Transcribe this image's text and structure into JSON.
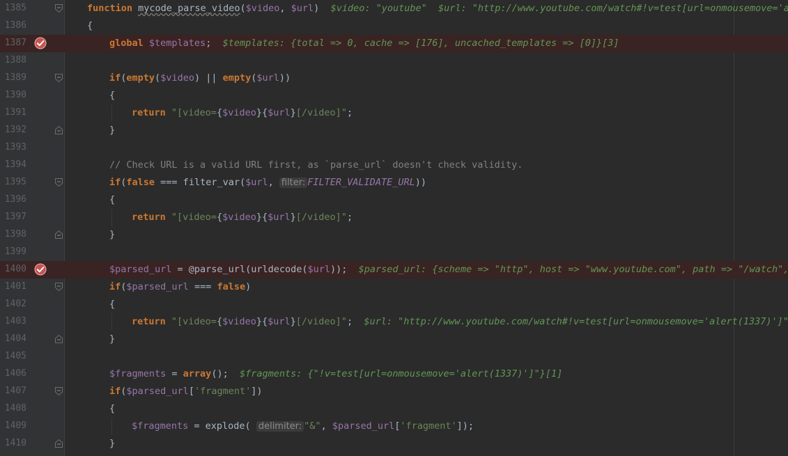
{
  "editor": {
    "colors": {
      "background": "#2b2b2b",
      "gutter": "#313335",
      "breakpoint_line": "#3a2323",
      "breakpoint_icon": "#c75450",
      "keyword": "#cc7832",
      "variable": "#9876aa",
      "string": "#6a8759",
      "comment": "#808080",
      "inline_value": "#629755"
    },
    "icons": {
      "breakpoint": "verified-breakpoint-icon",
      "fold": "fold-marker-icon"
    },
    "lines": [
      {
        "num": "1385",
        "breakpoint": false,
        "fold": "top",
        "indent": 0,
        "tokens": [
          {
            "t": "kw",
            "v": "function "
          },
          {
            "t": "fn-ul",
            "v": "mycode_parse_video"
          },
          {
            "t": "plain",
            "v": "("
          },
          {
            "t": "var",
            "v": "$video"
          },
          {
            "t": "plain",
            "v": ", "
          },
          {
            "t": "var",
            "v": "$url"
          },
          {
            "t": "plain",
            "v": ")  "
          },
          {
            "t": "inline-val",
            "v": "$video: \"youtube\"  $url: \"http://www.youtube.com/watch#!v=test[url=onmousemove='al"
          }
        ]
      },
      {
        "num": "1386",
        "breakpoint": false,
        "fold": null,
        "indent": 0,
        "tokens": [
          {
            "t": "plain",
            "v": "{"
          }
        ]
      },
      {
        "num": "1387",
        "breakpoint": true,
        "fold": null,
        "indent": 1,
        "tokens": [
          {
            "t": "kw",
            "v": "global "
          },
          {
            "t": "var",
            "v": "$templates"
          },
          {
            "t": "plain",
            "v": ";  "
          },
          {
            "t": "inline-val",
            "v": "$templates: {total => 0, cache => [176], uncached_templates => [0]}[3]"
          }
        ]
      },
      {
        "num": "1388",
        "breakpoint": false,
        "fold": null,
        "indent": 1,
        "tokens": []
      },
      {
        "num": "1389",
        "breakpoint": false,
        "fold": "top",
        "indent": 1,
        "tokens": [
          {
            "t": "kw",
            "v": "if"
          },
          {
            "t": "plain",
            "v": "("
          },
          {
            "t": "kw",
            "v": "empty"
          },
          {
            "t": "plain",
            "v": "("
          },
          {
            "t": "var",
            "v": "$video"
          },
          {
            "t": "plain",
            "v": ") || "
          },
          {
            "t": "kw",
            "v": "empty"
          },
          {
            "t": "plain",
            "v": "("
          },
          {
            "t": "var",
            "v": "$url"
          },
          {
            "t": "plain",
            "v": "))"
          }
        ]
      },
      {
        "num": "1390",
        "breakpoint": false,
        "fold": null,
        "indent": 1,
        "tokens": [
          {
            "t": "plain",
            "v": "{"
          }
        ]
      },
      {
        "num": "1391",
        "breakpoint": false,
        "fold": null,
        "indent": 2,
        "tokens": [
          {
            "t": "kw",
            "v": "return "
          },
          {
            "t": "str",
            "v": "\"[video="
          },
          {
            "t": "plain",
            "v": "{"
          },
          {
            "t": "var",
            "v": "$video"
          },
          {
            "t": "plain",
            "v": "}{"
          },
          {
            "t": "var",
            "v": "$url"
          },
          {
            "t": "plain",
            "v": "}"
          },
          {
            "t": "str",
            "v": "[/video]\""
          },
          {
            "t": "plain",
            "v": ";"
          }
        ]
      },
      {
        "num": "1392",
        "breakpoint": false,
        "fold": "bottom",
        "indent": 1,
        "tokens": [
          {
            "t": "plain",
            "v": "}"
          }
        ]
      },
      {
        "num": "1393",
        "breakpoint": false,
        "fold": null,
        "indent": 1,
        "tokens": []
      },
      {
        "num": "1394",
        "breakpoint": false,
        "fold": null,
        "indent": 1,
        "tokens": [
          {
            "t": "cmt",
            "v": "// Check URL is a valid URL first, as `parse_url` doesn't check validity."
          }
        ]
      },
      {
        "num": "1395",
        "breakpoint": false,
        "fold": "top",
        "indent": 1,
        "tokens": [
          {
            "t": "kw",
            "v": "if"
          },
          {
            "t": "plain",
            "v": "("
          },
          {
            "t": "kw",
            "v": "false"
          },
          {
            "t": "plain",
            "v": " === filter_var("
          },
          {
            "t": "var",
            "v": "$url"
          },
          {
            "t": "plain",
            "v": ", "
          },
          {
            "t": "hint",
            "v": "filter:"
          },
          {
            "t": "const",
            "v": "FILTER_VALIDATE_URL"
          },
          {
            "t": "plain",
            "v": "))"
          }
        ]
      },
      {
        "num": "1396",
        "breakpoint": false,
        "fold": null,
        "indent": 1,
        "tokens": [
          {
            "t": "plain",
            "v": "{"
          }
        ]
      },
      {
        "num": "1397",
        "breakpoint": false,
        "fold": null,
        "indent": 2,
        "tokens": [
          {
            "t": "kw",
            "v": "return "
          },
          {
            "t": "str",
            "v": "\"[video="
          },
          {
            "t": "plain",
            "v": "{"
          },
          {
            "t": "var",
            "v": "$video"
          },
          {
            "t": "plain",
            "v": "}{"
          },
          {
            "t": "var",
            "v": "$url"
          },
          {
            "t": "plain",
            "v": "}"
          },
          {
            "t": "str",
            "v": "[/video]\""
          },
          {
            "t": "plain",
            "v": ";"
          }
        ]
      },
      {
        "num": "1398",
        "breakpoint": false,
        "fold": "bottom",
        "indent": 1,
        "tokens": [
          {
            "t": "plain",
            "v": "}"
          }
        ]
      },
      {
        "num": "1399",
        "breakpoint": false,
        "fold": null,
        "indent": 1,
        "tokens": []
      },
      {
        "num": "1400",
        "breakpoint": true,
        "fold": null,
        "indent": 1,
        "tokens": [
          {
            "t": "var",
            "v": "$parsed_url"
          },
          {
            "t": "plain",
            "v": " = @parse_url(urldecode("
          },
          {
            "t": "var",
            "v": "$url"
          },
          {
            "t": "plain",
            "v": "));  "
          },
          {
            "t": "inline-val",
            "v": "$parsed_url: {scheme => \"http\", host => \"www.youtube.com\", path => \"/watch\", f"
          }
        ]
      },
      {
        "num": "1401",
        "breakpoint": false,
        "fold": "top",
        "indent": 1,
        "tokens": [
          {
            "t": "kw",
            "v": "if"
          },
          {
            "t": "plain",
            "v": "("
          },
          {
            "t": "var",
            "v": "$parsed_url"
          },
          {
            "t": "plain",
            "v": " === "
          },
          {
            "t": "kw",
            "v": "false"
          },
          {
            "t": "plain",
            "v": ")"
          }
        ]
      },
      {
        "num": "1402",
        "breakpoint": false,
        "fold": null,
        "indent": 1,
        "tokens": [
          {
            "t": "plain",
            "v": "{"
          }
        ]
      },
      {
        "num": "1403",
        "breakpoint": false,
        "fold": null,
        "indent": 2,
        "tokens": [
          {
            "t": "kw",
            "v": "return "
          },
          {
            "t": "str",
            "v": "\"[video="
          },
          {
            "t": "plain",
            "v": "{"
          },
          {
            "t": "var",
            "v": "$video"
          },
          {
            "t": "plain",
            "v": "}{"
          },
          {
            "t": "var",
            "v": "$url"
          },
          {
            "t": "plain",
            "v": "}"
          },
          {
            "t": "str",
            "v": "[/video]\""
          },
          {
            "t": "plain",
            "v": ";  "
          },
          {
            "t": "inline-val",
            "v": "$url: \"http://www.youtube.com/watch#!v=test[url=onmousemove='alert(1337)']\""
          }
        ]
      },
      {
        "num": "1404",
        "breakpoint": false,
        "fold": "bottom",
        "indent": 1,
        "tokens": [
          {
            "t": "plain",
            "v": "}"
          }
        ]
      },
      {
        "num": "1405",
        "breakpoint": false,
        "fold": null,
        "indent": 1,
        "tokens": []
      },
      {
        "num": "1406",
        "breakpoint": false,
        "fold": null,
        "indent": 1,
        "tokens": [
          {
            "t": "var",
            "v": "$fragments"
          },
          {
            "t": "plain",
            "v": " = "
          },
          {
            "t": "kw",
            "v": "array"
          },
          {
            "t": "plain",
            "v": "();  "
          },
          {
            "t": "inline-val",
            "v": "$fragments: {\"!v=test[url=onmousemove='alert(1337)']\"}[1]"
          }
        ]
      },
      {
        "num": "1407",
        "breakpoint": false,
        "fold": "top",
        "indent": 1,
        "tokens": [
          {
            "t": "kw",
            "v": "if"
          },
          {
            "t": "plain",
            "v": "("
          },
          {
            "t": "var",
            "v": "$parsed_url"
          },
          {
            "t": "plain",
            "v": "["
          },
          {
            "t": "str",
            "v": "'fragment'"
          },
          {
            "t": "plain",
            "v": "])"
          }
        ]
      },
      {
        "num": "1408",
        "breakpoint": false,
        "fold": null,
        "indent": 1,
        "tokens": [
          {
            "t": "plain",
            "v": "{"
          }
        ]
      },
      {
        "num": "1409",
        "breakpoint": false,
        "fold": null,
        "indent": 2,
        "tokens": [
          {
            "t": "var",
            "v": "$fragments"
          },
          {
            "t": "plain",
            "v": " = explode( "
          },
          {
            "t": "hint",
            "v": "delimiter:"
          },
          {
            "t": "str",
            "v": "\"&\""
          },
          {
            "t": "plain",
            "v": ", "
          },
          {
            "t": "var",
            "v": "$parsed_url"
          },
          {
            "t": "plain",
            "v": "["
          },
          {
            "t": "str",
            "v": "'fragment'"
          },
          {
            "t": "plain",
            "v": "]);"
          }
        ]
      },
      {
        "num": "1410",
        "breakpoint": false,
        "fold": "bottom",
        "indent": 1,
        "tokens": [
          {
            "t": "plain",
            "v": "}"
          }
        ]
      }
    ]
  }
}
